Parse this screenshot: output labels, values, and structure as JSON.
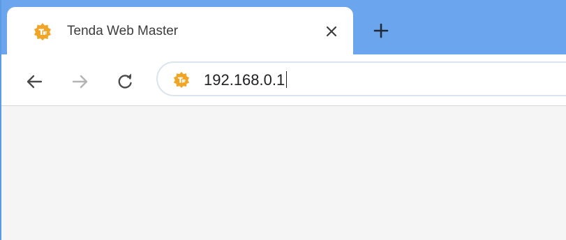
{
  "tab": {
    "title": "Tenda Web Master",
    "favicon": "tenda-logo-icon",
    "close_icon": "close-icon"
  },
  "new_tab_icon": "plus-icon",
  "toolbar": {
    "back_icon": "arrow-left-icon",
    "forward_icon": "arrow-right-icon",
    "reload_icon": "reload-icon"
  },
  "omnibox": {
    "favicon": "tenda-logo-icon",
    "url": "192.168.0.1"
  },
  "colors": {
    "tabstrip": "#6aa5ee",
    "favicon": "#f0a526",
    "tab_background": "#ffffff",
    "content_background": "#f5f5f5"
  }
}
